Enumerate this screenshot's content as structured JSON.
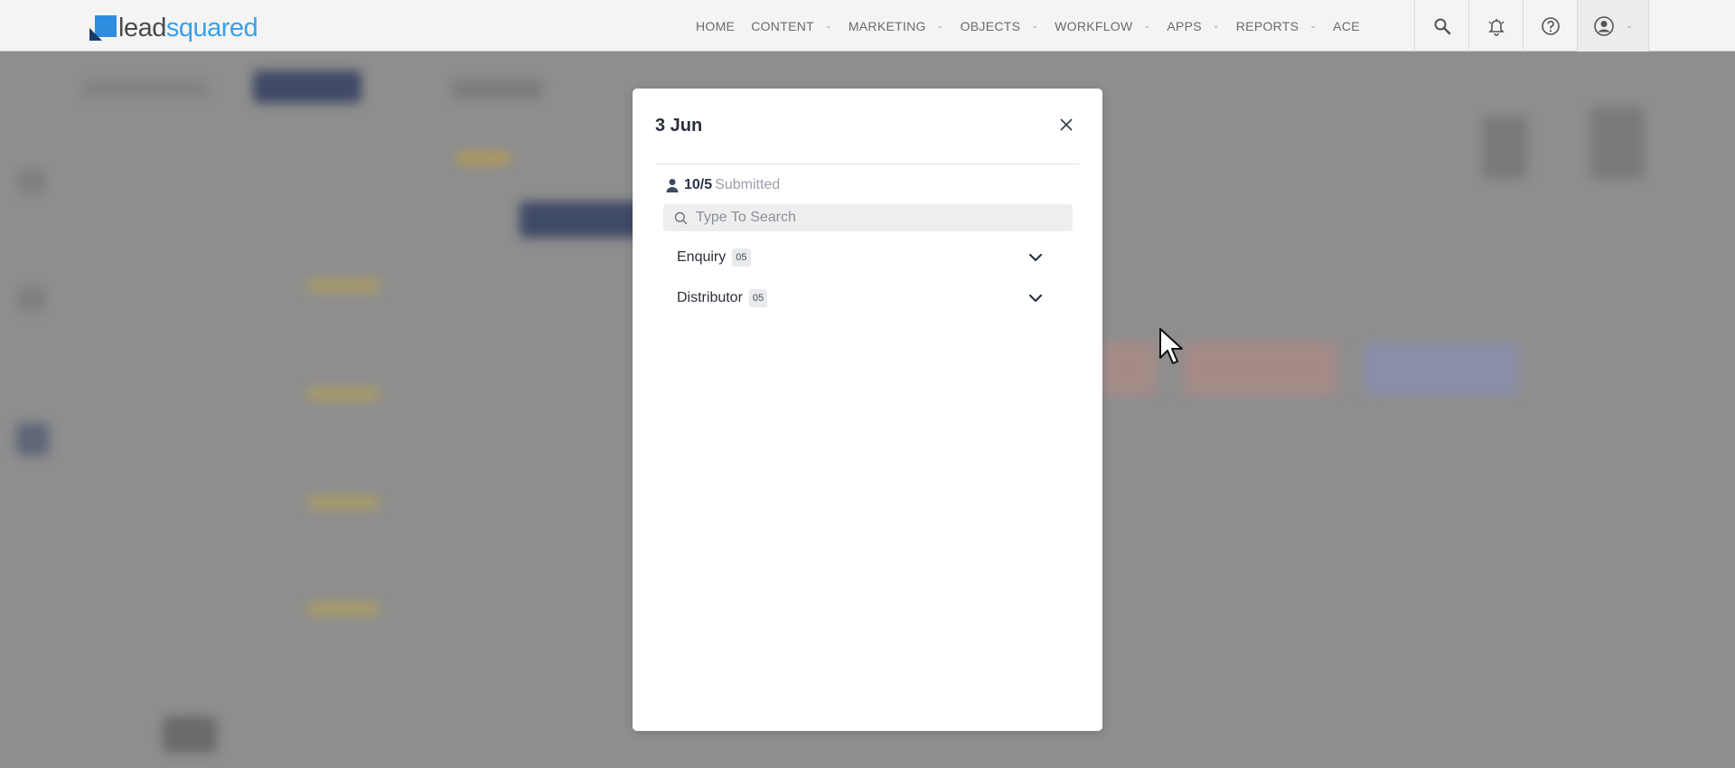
{
  "app": {
    "logo_text_lead": "lead",
    "logo_text_squared": "squared",
    "brand_color": "#2d8ee0"
  },
  "nav": {
    "items": [
      {
        "label": "HOME",
        "has_caret": false
      },
      {
        "label": "CONTENT",
        "has_caret": true
      },
      {
        "label": "MARKETING",
        "has_caret": true
      },
      {
        "label": "OBJECTS",
        "has_caret": true
      },
      {
        "label": "WORKFLOW",
        "has_caret": true
      },
      {
        "label": "APPS",
        "has_caret": true
      },
      {
        "label": "REPORTS",
        "has_caret": true
      },
      {
        "label": "ACE",
        "has_caret": false
      }
    ],
    "icons": [
      "search-icon",
      "notification-bell-icon",
      "help-icon",
      "user-profile-icon"
    ]
  },
  "modal": {
    "title": "3 Jun",
    "submitted_count": "10/5",
    "submitted_label": "Submitted",
    "search_placeholder": "Type To Search",
    "groups": [
      {
        "name": "Enquiry",
        "count": "05"
      },
      {
        "name": "Distributor",
        "count": "05"
      }
    ]
  }
}
